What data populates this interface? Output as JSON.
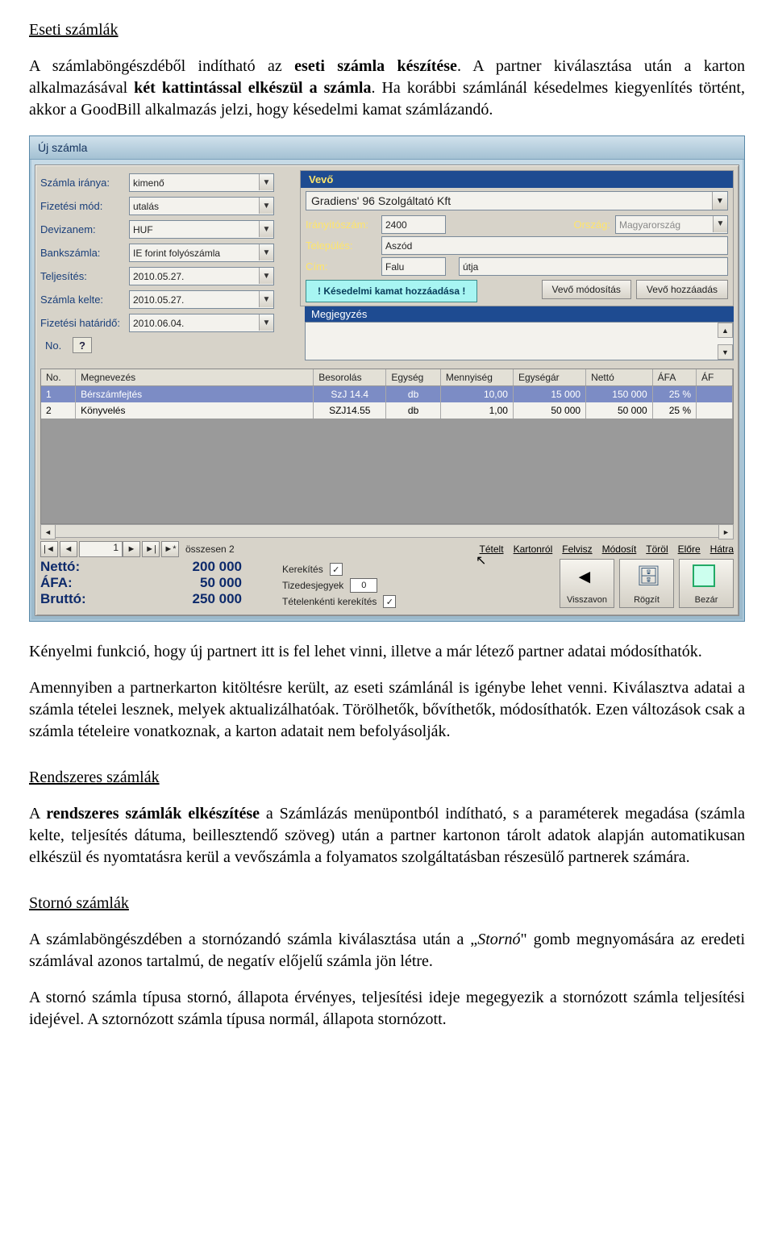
{
  "doc": {
    "h1": "Eseti számlák",
    "p1a": "A számlaböngészdéből indítható az ",
    "p1b": "eseti számla készítése",
    "p1c": ". A partner kiválasztása után a karton alkalmazásával ",
    "p1d": "két kattintással elkészül a számla",
    "p1e": ". Ha korábbi számlánál késedelmes kiegyenlítés történt, akkor a GoodBill alkalmazás jelzi, hogy késedelmi kamat számlázandó.",
    "p2": "Kényelmi funkció, hogy új partnert itt is fel lehet vinni, illetve a már létező partner adatai módosíthatók.",
    "p3": "Amennyiben a partnerkarton kitöltésre került, az eseti számlánál is igénybe lehet venni. Kiválasztva adatai a számla tételei lesznek, melyek aktualizálhatóak. Törölhetők, bővíthetők, módosíthatók. Ezen változások csak a számla tételeire vonatkoznak, a karton adatait nem befolyásolják.",
    "h2": "Rendszeres számlák",
    "p4a": "A ",
    "p4b": "rendszeres számlák elkészítése",
    "p4c": " a Számlázás menüpontból indítható, s a paraméterek megadása (számla kelte, teljesítés dátuma, beillesztendő szöveg) után a partner kartonon tárolt adatok alapján automatikusan elkészül és nyomtatásra kerül a vevőszámla a folyamatos szolgáltatásban részesülő partnerek számára.",
    "h3": "Stornó számlák",
    "p5a": "A számlaböngészdében a stornózandó számla kiválasztása után a „",
    "p5b": "Stornó",
    "p5c": "\" gomb megnyomására az eredeti számlával azonos tartalmú, de negatív előjelű számla jön létre.",
    "p6": "A stornó számla típusa stornó, állapota érvényes, teljesítési ideje megegyezik a stornózott számla teljesítési idejével. A sztornózott számla típusa normál, állapota stornózott."
  },
  "win": {
    "title": "Új számla",
    "left": {
      "irany_lbl": "Számla iránya:",
      "irany_val": "kimenő",
      "fizmod_lbl": "Fizetési mód:",
      "fizmod_val": "utalás",
      "deviza_lbl": "Devizanem:",
      "deviza_val": "HUF",
      "bank_lbl": "Bankszámla:",
      "bank_val": "IE forint folyószámla",
      "telj_lbl": "Teljesítés:",
      "telj_val": "2010.05.27.",
      "kelt_lbl": "Számla kelte:",
      "kelt_val": "2010.05.27.",
      "hatar_lbl": "Fizetési határidő:",
      "hatar_val": "2010.06.04.",
      "no_lbl": "No.",
      "no_q": "?"
    },
    "right": {
      "vevo_lbl": "Vevő",
      "buyer": "Gradiens' 96 Szolgáltató Kft",
      "zip_lbl": "Irányítószám:",
      "zip_val": "2400",
      "country_lbl": "Ország:",
      "country_val": "Magyarország",
      "town_lbl": "Település:",
      "town_val": "Aszód",
      "addr_lbl": "Cím:",
      "addr_val1": "Falu",
      "addr_val2": "útja",
      "warn": "! Késedelmi kamat hozzáadása !",
      "btn_mod": "Vevő módosítás",
      "btn_add": "Vevő hozzáadás",
      "memo_lbl": "Megjegyzés"
    },
    "grid": {
      "h_no": "No.",
      "h_name": "Megnevezés",
      "h_bes": "Besorolás",
      "h_egy": "Egység",
      "h_meny": "Mennyiség",
      "h_ar": "Egységár",
      "h_net": "Nettó",
      "h_afa": "ÁFA",
      "h_af2": "ÁF",
      "rows": [
        {
          "no": "1",
          "name": "Bérszámfejtés",
          "bes": "SzJ 14.4",
          "egy": "db",
          "meny": "10,00",
          "ar": "15 000",
          "net": "150 000",
          "afa": "25 %"
        },
        {
          "no": "2",
          "name": "Könyvelés",
          "bes": "SZJ14.55",
          "egy": "db",
          "meny": "1,00",
          "ar": "50 000",
          "net": "50 000",
          "afa": "25 %"
        }
      ]
    },
    "nav": {
      "pos": "1",
      "total": "összesen 2",
      "tetelt": "Tételt",
      "kartonrol": "Kartonról",
      "felvisz": "Felvisz",
      "modosit": "Módosít",
      "torol": "Töröl",
      "elore": "Előre",
      "hatra": "Hátra"
    },
    "totals": {
      "netto_k": "Nettó:",
      "netto_v": "200 000",
      "afa_k": "ÁFA:",
      "afa_v": "50 000",
      "brutto_k": "Bruttó:",
      "brutto_v": "250 000"
    },
    "opts": {
      "kerek": "Kerekítés",
      "tized": "Tizedesjegyek",
      "tized_val": "0",
      "tetel_kerek": "Tételenkénti kerekítés"
    },
    "actions": {
      "undo": "Visszavon",
      "save": "Rögzít",
      "close": "Bezár"
    }
  }
}
